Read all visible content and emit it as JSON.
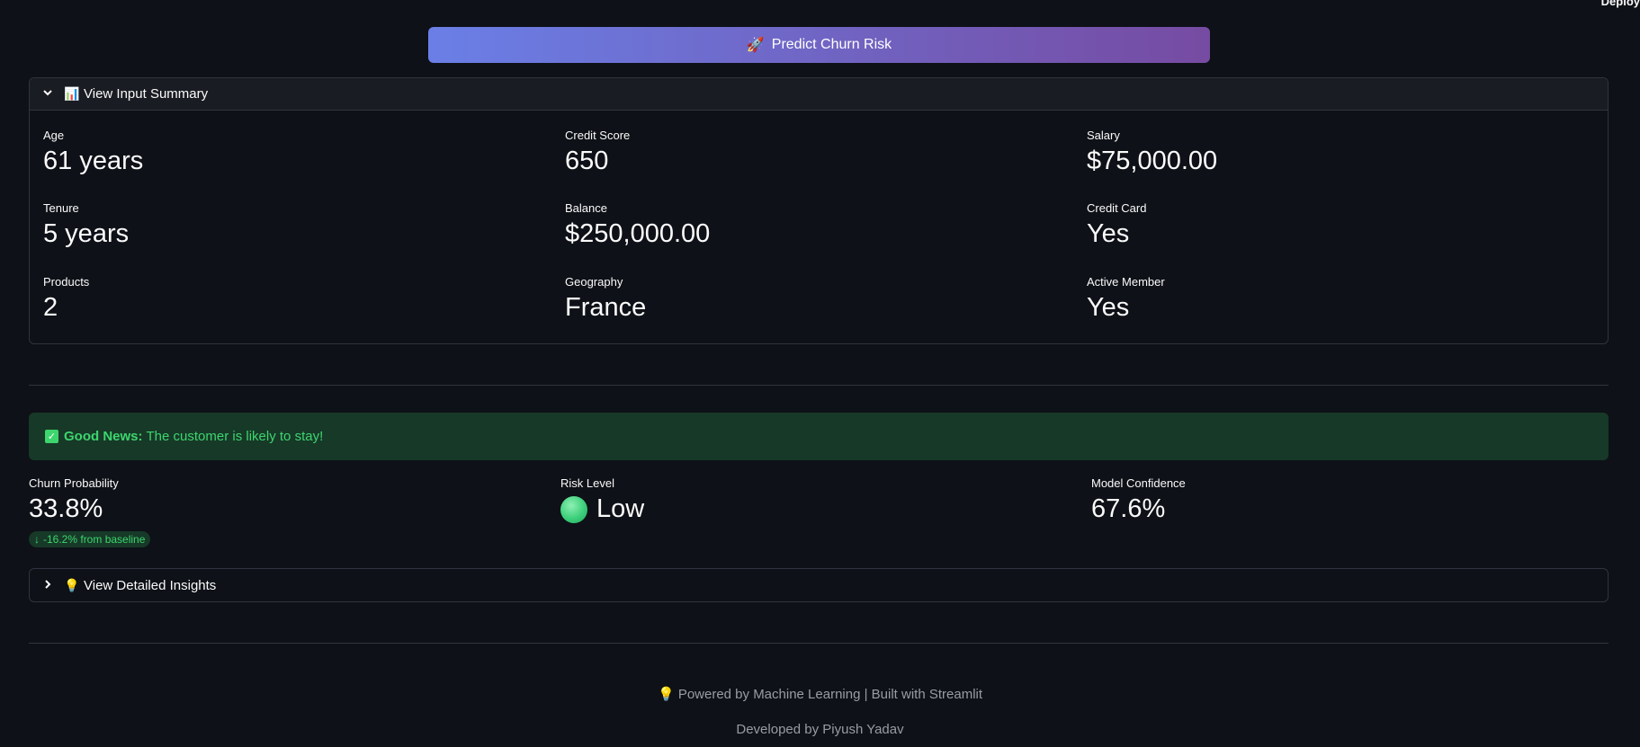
{
  "header": {
    "deploy_label": "Deploy"
  },
  "predict_button": {
    "icon": "rocket-icon",
    "label": "Predict Churn Risk"
  },
  "input_summary": {
    "title": "View Input Summary",
    "icon": "bar-chart-icon",
    "metrics": [
      {
        "label": "Age",
        "value": "61 years"
      },
      {
        "label": "Credit Score",
        "value": "650"
      },
      {
        "label": "Salary",
        "value": "$75,000.00"
      },
      {
        "label": "Tenure",
        "value": "5 years"
      },
      {
        "label": "Balance",
        "value": "$250,000.00"
      },
      {
        "label": "Credit Card",
        "value": "Yes"
      },
      {
        "label": "Products",
        "value": "2"
      },
      {
        "label": "Geography",
        "value": "France"
      },
      {
        "label": "Active Member",
        "value": "Yes"
      }
    ]
  },
  "result": {
    "bold": "Good News:",
    "message": "The customer is likely to stay!",
    "color": "#3dd56d"
  },
  "results_metrics": {
    "churn": {
      "label": "Churn Probability",
      "value": "33.8%",
      "delta": "-16.2% from baseline"
    },
    "risk": {
      "label": "Risk Level",
      "value": "Low"
    },
    "confidence": {
      "label": "Model Confidence",
      "value": "67.6%"
    }
  },
  "insights": {
    "title": "View Detailed Insights",
    "icon": "lightbulb-icon"
  },
  "footer": {
    "powered": "Powered by Machine Learning | Built with Streamlit",
    "developer": "Developed by Piyush Yadav"
  },
  "colors": {
    "background": "#0e1117",
    "gradient_start": "#6a7fe6",
    "gradient_end": "#764ba2"
  }
}
